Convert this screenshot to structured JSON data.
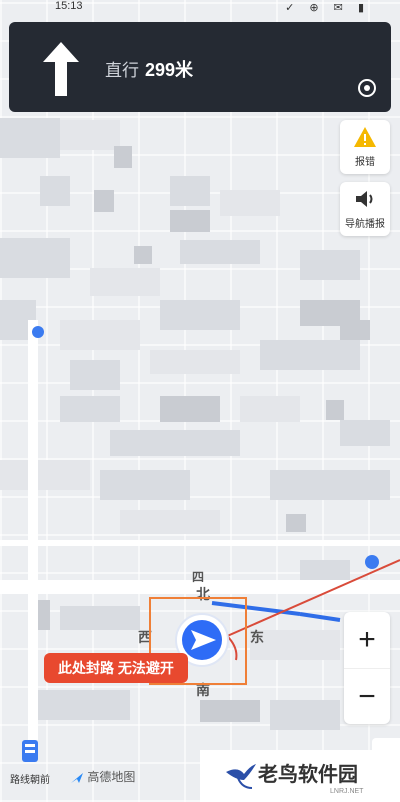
{
  "status_bar": {
    "time": "15:13",
    "icons": "✓ ⊕ ✉ ▮"
  },
  "navigation": {
    "instruction": "直行",
    "distance": "299米"
  },
  "side_buttons": {
    "report_label": "报错",
    "broadcast_label": "导航播报"
  },
  "zoom": {
    "in_label": "+",
    "out_label": "−"
  },
  "map": {
    "closed_road_notice": "此处封路 无法避开",
    "label_north": "北",
    "label_south": "南",
    "label_west": "西",
    "label_east": "东",
    "label_char": "四"
  },
  "bottom": {
    "route_preview_label": "路线朝前",
    "amap_brand": "高德地图"
  },
  "watermark": {
    "name": "老鸟软件园",
    "domain": "LNRJ.NET"
  },
  "colors": {
    "nav_card": "#252a33",
    "closed_banner": "#e8492f",
    "focus_box": "#ef7f37",
    "car_marker": "#2e6cf6",
    "route_blue": "#2f6de8",
    "route_red": "#d94b3a"
  }
}
